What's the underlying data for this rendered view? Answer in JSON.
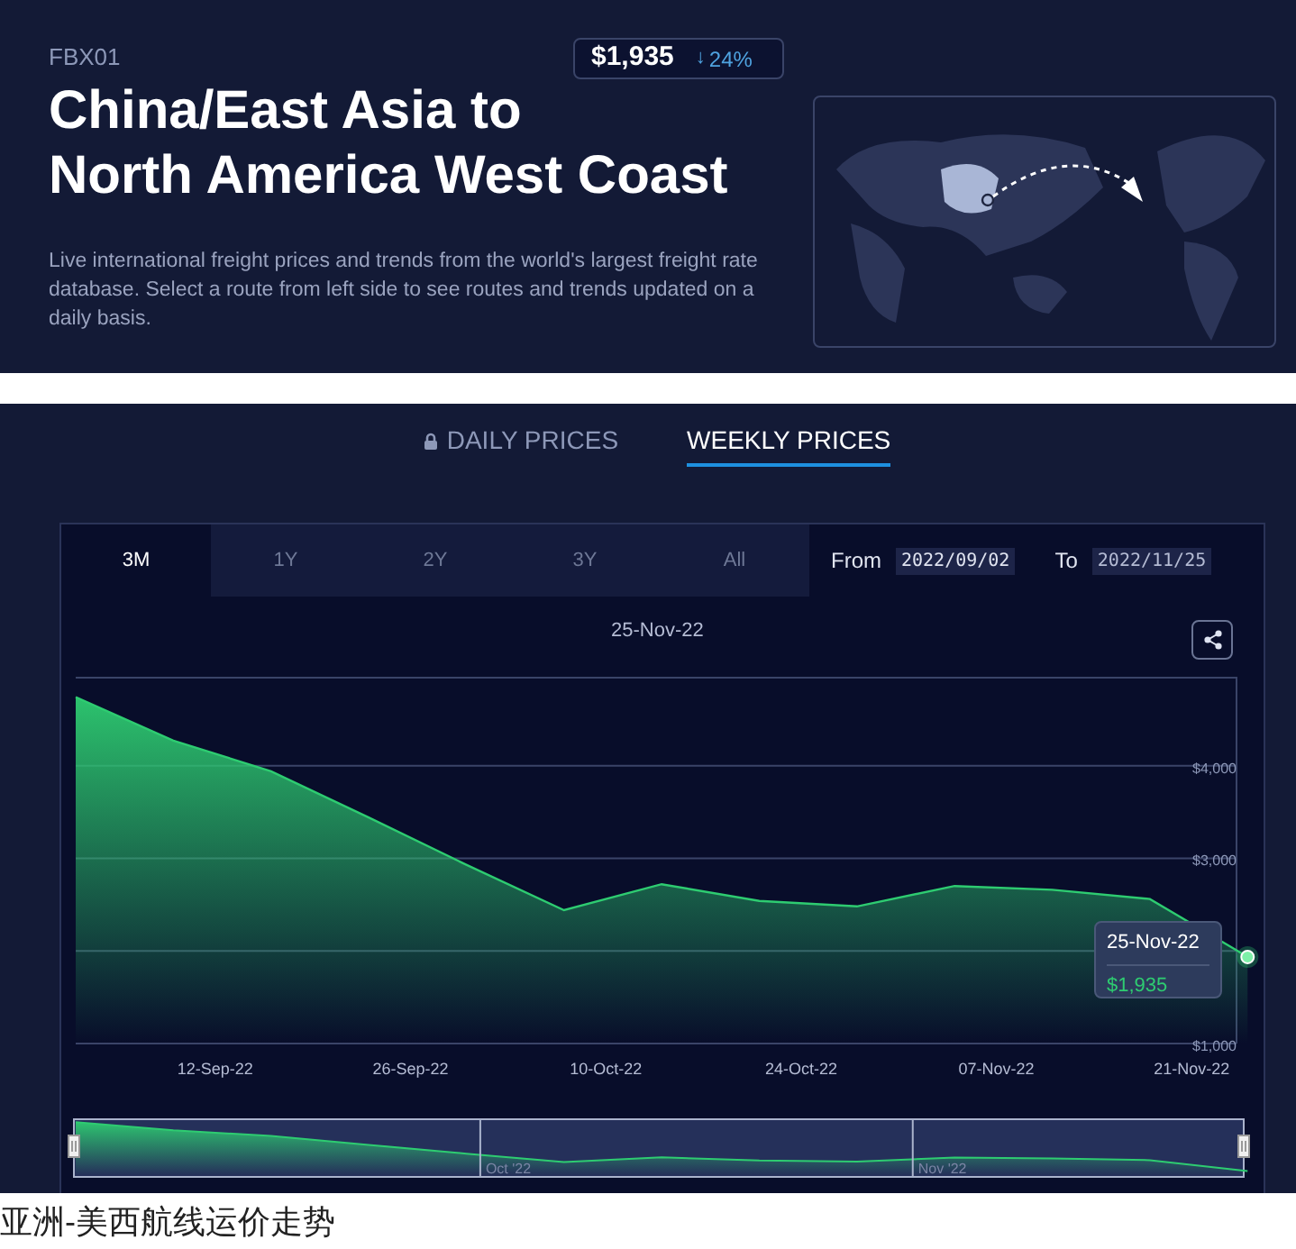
{
  "header": {
    "code": "FBX01",
    "price": "$1,935",
    "change": "24%",
    "change_arrow": "↓",
    "title_lines": [
      "China/East Asia to",
      "North America West Coast"
    ],
    "description": "Live international freight prices and trends from the world's largest freight rate database. Select a route from left side to see routes and trends updated on a daily basis."
  },
  "price_tabs": [
    {
      "label": "DAILY PRICES",
      "locked": true,
      "selected": false
    },
    {
      "label": "WEEKLY PRICES",
      "locked": false,
      "selected": true
    }
  ],
  "range_buttons": [
    {
      "label": "3M",
      "selected": true
    },
    {
      "label": "1Y",
      "selected": false
    },
    {
      "label": "2Y",
      "selected": false
    },
    {
      "label": "3Y",
      "selected": false
    },
    {
      "label": "All",
      "selected": false
    }
  ],
  "date_from": {
    "label": "From",
    "value": "2022/09/02"
  },
  "date_to": {
    "label": "To",
    "value": "2022/11/25"
  },
  "hover_date": "25-Nov-22",
  "tooltip": {
    "date": "25-Nov-22",
    "value": "$1,935"
  },
  "chart_data": {
    "type": "area",
    "categories": [
      null,
      null,
      null,
      null,
      null,
      null,
      null,
      null,
      null,
      null,
      "12-Sep-22",
      null,
      null,
      null,
      null,
      null,
      null,
      null,
      null,
      null,
      null,
      null,
      null,
      null,
      "26-Sep-22",
      null,
      null,
      null,
      null,
      null,
      null,
      null,
      null,
      null,
      null,
      null,
      null,
      null,
      "10-Oct-22",
      null,
      null,
      null,
      null,
      null,
      null,
      null,
      null,
      null,
      null,
      null,
      null,
      null,
      "24-Oct-22",
      null,
      null,
      null,
      null,
      null,
      null,
      null,
      null,
      null,
      null,
      null,
      null,
      null,
      "07-Nov-22",
      null,
      null,
      null,
      null,
      null,
      null,
      null,
      null,
      null,
      null,
      null,
      null,
      null,
      "21-Nov-22",
      null,
      null,
      null,
      null
    ],
    "series": [
      {
        "color": "#2ecc71",
        "values": [
          4740,
          null,
          null,
          null,
          null,
          null,
          null,
          4270,
          null,
          null,
          null,
          null,
          null,
          null,
          3940,
          null,
          null,
          null,
          null,
          null,
          null,
          3440,
          null,
          null,
          null,
          null,
          null,
          null,
          2930,
          null,
          null,
          null,
          null,
          null,
          null,
          2440,
          null,
          null,
          null,
          null,
          null,
          null,
          2720,
          null,
          null,
          null,
          null,
          null,
          null,
          2540,
          null,
          null,
          null,
          null,
          null,
          null,
          2480,
          null,
          null,
          null,
          null,
          null,
          null,
          2700,
          null,
          null,
          null,
          null,
          null,
          null,
          2660,
          null,
          null,
          null,
          null,
          null,
          null,
          2560,
          null,
          null,
          null,
          null,
          null,
          null,
          1935
        ]
      }
    ],
    "ylim": [
      1000,
      4950
    ],
    "yticks": [
      {
        "value": 1000,
        "label": "$1,000"
      },
      {
        "value": 3000,
        "label": "$3,000"
      },
      {
        "value": 4000,
        "label": "$4,000"
      }
    ]
  },
  "navigator": {
    "labels": [
      "Oct '22",
      "Nov '22"
    ]
  },
  "caption": "亚洲-美西航线运价走势"
}
